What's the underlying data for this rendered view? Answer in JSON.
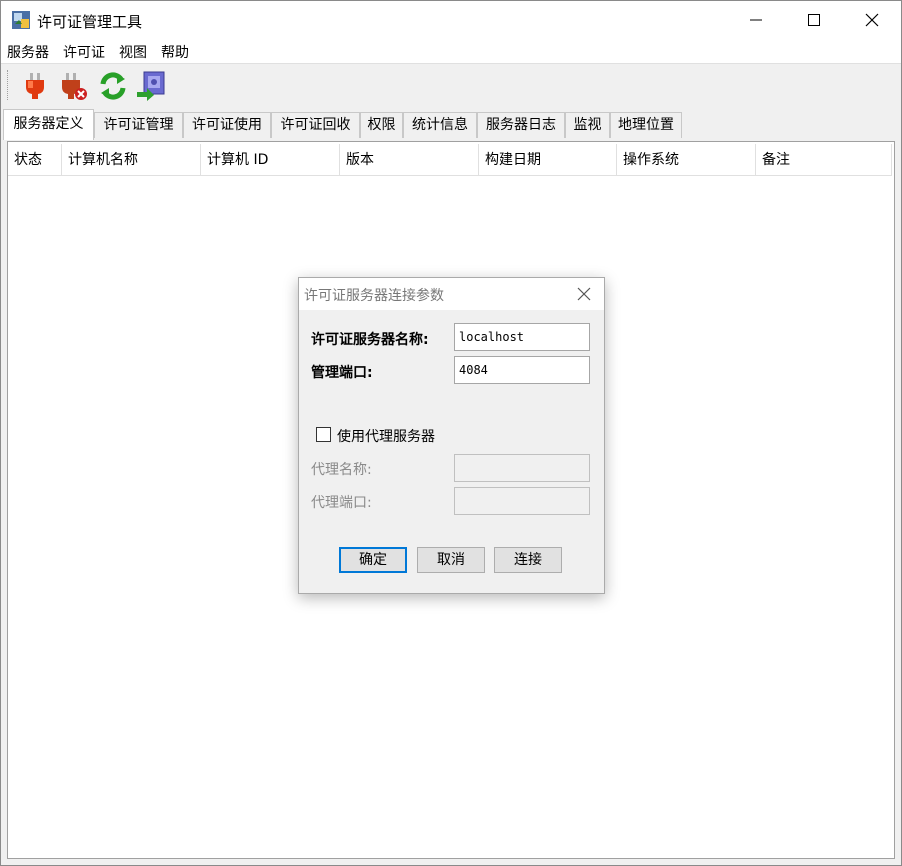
{
  "window": {
    "title": "许可证管理工具"
  },
  "menu": [
    "服务器",
    "许可证",
    "视图",
    "帮助"
  ],
  "toolbar": {
    "buttons": [
      "connect-plug-icon",
      "disconnect-plug-icon",
      "refresh-icon",
      "export-icon"
    ]
  },
  "tabs": [
    "服务器定义",
    "许可证管理",
    "许可证使用",
    "许可证回收",
    "权限",
    "统计信息",
    "服务器日志",
    "监视",
    "地理位置"
  ],
  "table": {
    "columns": [
      "状态",
      "计算机名称",
      "计算机 ID",
      "版本",
      "构建日期",
      "操作系统",
      "备注"
    ]
  },
  "dialog": {
    "title": "许可证服务器连接参数",
    "server_name_label": "许可证服务器名称:",
    "server_name_value": "localhost",
    "port_label": "管理端口:",
    "port_value": "4084",
    "use_proxy_label": "使用代理服务器",
    "proxy_name_label": "代理名称:",
    "proxy_name_value": "",
    "proxy_port_label": "代理端口:",
    "proxy_port_value": "",
    "ok": "确定",
    "cancel": "取消",
    "connect": "连接"
  }
}
